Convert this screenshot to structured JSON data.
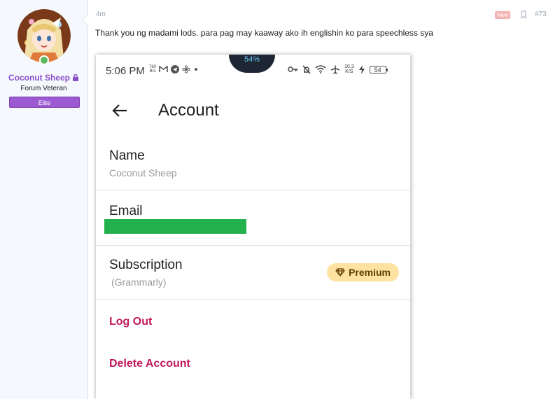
{
  "forum": {
    "username": "Coconut Sheep",
    "user_title": "Forum Veteran",
    "banner": "Elite",
    "post_time": "4m",
    "new_badge": "New",
    "post_number": "#73",
    "post_text": "Thank you ng madami lods. para pag may kaaway ako ih englishin ko para speechless sya"
  },
  "phone": {
    "status_time": "5:06 PM",
    "status_speed_small": [
      "760",
      "B/s"
    ],
    "battery_notch": "54%",
    "net_rate": [
      "10.3",
      "K/S"
    ],
    "battery": "54",
    "title": "Account",
    "name_label": "Name",
    "name_value": "Coconut Sheep",
    "email_label": "Email",
    "subscription_label": "Subscription",
    "subscription_value": "(Grammarly)",
    "premium_label": "Premium",
    "logout_label": "Log Out",
    "delete_label": "Delete Account"
  },
  "colors": {
    "username": "#8b4fc9",
    "banner": "#9c59d1",
    "premium_bg": "#fde2a1",
    "action_red": "#c2185b",
    "redaction": "#22b14c"
  }
}
